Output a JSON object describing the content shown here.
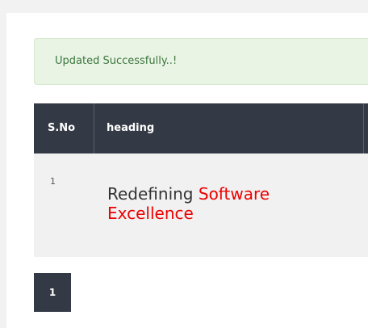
{
  "alert": {
    "message": "Updated Successfully..!"
  },
  "table": {
    "columns": [
      "S.No",
      "heading"
    ],
    "rows": [
      {
        "sno": "1",
        "heading_plain": "Redefining",
        "heading_accent": "Software Excellence"
      }
    ]
  },
  "pagination": {
    "pages": [
      "1"
    ],
    "current": "1"
  },
  "colors": {
    "header_bg": "#343a45",
    "alert_bg": "#e9f4e5",
    "alert_text": "#3c763d",
    "accent": "#ee0000"
  }
}
